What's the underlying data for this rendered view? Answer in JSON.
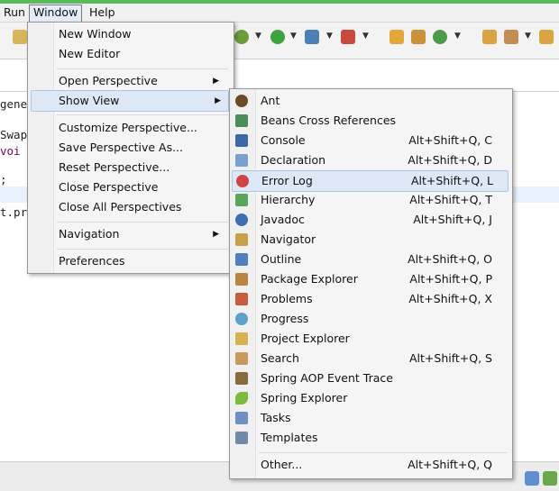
{
  "menubar": {
    "run": "Run",
    "window": "Window",
    "help": "Help"
  },
  "editor_lines": [
    "gene",
    "Swap",
    "voi",
    ";",
    "t.pr"
  ],
  "window_menu": {
    "items": [
      {
        "label": "New Window"
      },
      {
        "label": "New Editor"
      },
      {
        "label": "Open Perspective",
        "submenu": true
      },
      {
        "label": "Show View",
        "submenu": true
      },
      {
        "label": "Customize Perspective..."
      },
      {
        "label": "Save Perspective As..."
      },
      {
        "label": "Reset Perspective..."
      },
      {
        "label": "Close Perspective"
      },
      {
        "label": "Close All Perspectives"
      },
      {
        "label": "Navigation",
        "submenu": true
      },
      {
        "label": "Preferences"
      }
    ]
  },
  "show_view_menu": {
    "items": [
      {
        "label": "Ant",
        "shortcut": "",
        "icon": "ant-icon"
      },
      {
        "label": "Beans Cross References",
        "shortcut": "",
        "icon": "beans-icon"
      },
      {
        "label": "Console",
        "shortcut": "Alt+Shift+Q, C",
        "icon": "console-icon"
      },
      {
        "label": "Declaration",
        "shortcut": "Alt+Shift+Q, D",
        "icon": "declaration-icon"
      },
      {
        "label": "Error Log",
        "shortcut": "Alt+Shift+Q, L",
        "icon": "error-log-icon"
      },
      {
        "label": "Hierarchy",
        "shortcut": "Alt+Shift+Q, T",
        "icon": "hierarchy-icon"
      },
      {
        "label": "Javadoc",
        "shortcut": "Alt+Shift+Q, J",
        "icon": "javadoc-icon"
      },
      {
        "label": "Navigator",
        "shortcut": "",
        "icon": "navigator-icon"
      },
      {
        "label": "Outline",
        "shortcut": "Alt+Shift+Q, O",
        "icon": "outline-icon"
      },
      {
        "label": "Package Explorer",
        "shortcut": "Alt+Shift+Q, P",
        "icon": "package-explorer-icon"
      },
      {
        "label": "Problems",
        "shortcut": "Alt+Shift+Q, X",
        "icon": "problems-icon"
      },
      {
        "label": "Progress",
        "shortcut": "",
        "icon": "progress-icon"
      },
      {
        "label": "Project Explorer",
        "shortcut": "",
        "icon": "project-explorer-icon"
      },
      {
        "label": "Search",
        "shortcut": "Alt+Shift+Q, S",
        "icon": "search-icon"
      },
      {
        "label": "Spring AOP Event Trace",
        "shortcut": "",
        "icon": "aop-trace-icon"
      },
      {
        "label": "Spring Explorer",
        "shortcut": "",
        "icon": "spring-explorer-icon"
      },
      {
        "label": "Tasks",
        "shortcut": "",
        "icon": "tasks-icon"
      },
      {
        "label": "Templates",
        "shortcut": "",
        "icon": "templates-icon"
      },
      {
        "label": "Other...",
        "shortcut": "Alt+Shift+Q, Q",
        "icon": ""
      }
    ]
  },
  "colors": {
    "accent_stripe": "#5cb85c",
    "highlight": "#dde8f7"
  }
}
